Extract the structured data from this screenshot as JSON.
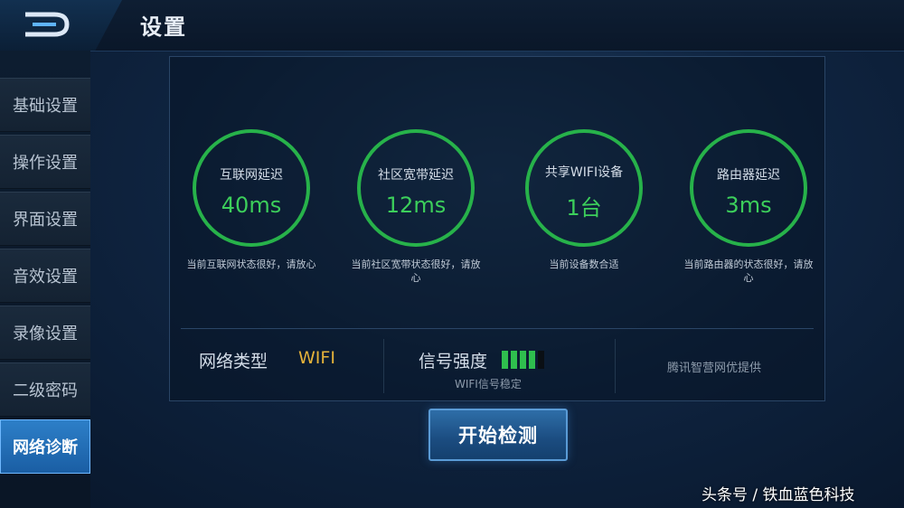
{
  "header": {
    "title": "设置",
    "back_icon": "back-logo-icon"
  },
  "sidebar": {
    "items": [
      {
        "label": "基础设置"
      },
      {
        "label": "操作设置"
      },
      {
        "label": "界面设置"
      },
      {
        "label": "音效设置"
      },
      {
        "label": "录像设置"
      },
      {
        "label": "二级密码"
      },
      {
        "label": "网络诊断",
        "active": true
      }
    ]
  },
  "stats": [
    {
      "label": "互联网延迟",
      "value": "40ms",
      "note": "当前互联网状态很好，请放心"
    },
    {
      "label": "社区宽带延迟",
      "value": "12ms",
      "note": "当前社区宽带状态很好，请放心"
    },
    {
      "label": "共享WIFI设备",
      "value": "1台",
      "note": "当前设备数合适"
    },
    {
      "label": "路由器延迟",
      "value": "3ms",
      "note": "当前路由器的状态很好，请放心"
    }
  ],
  "network": {
    "type_label": "网络类型",
    "type_value": "WIFI",
    "signal_label": "信号强度",
    "signal_bars_on": 4,
    "signal_bars_total": 5,
    "signal_note": "WIFI信号稳定",
    "provider": "腾讯智营网优提供"
  },
  "actions": {
    "start_label": "开始检测"
  },
  "watermark": "头条号 / 铁血蓝色科技",
  "colors": {
    "ring": "#27b24a",
    "value": "#3ccf5b",
    "wifi": "#e6b33a",
    "active_tab": "#2d7fc8"
  }
}
